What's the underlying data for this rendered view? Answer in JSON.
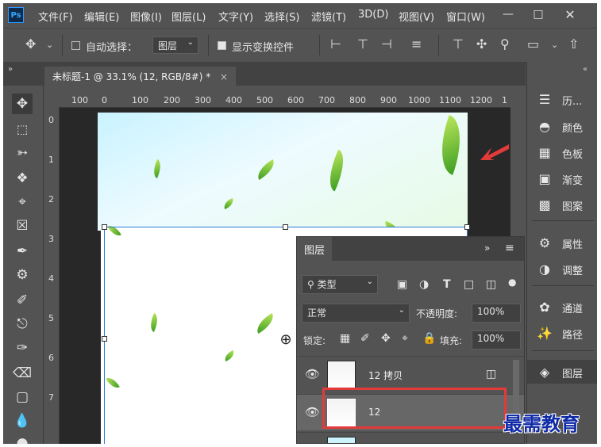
{
  "app": {
    "logo": "Ps",
    "menu": [
      "文件(F)",
      "编辑(E)",
      "图像(I)",
      "图层(L)",
      "文字(Y)",
      "选择(S)",
      "滤镜(T)",
      "3D(D)",
      "视图(V)",
      "窗口(W)"
    ],
    "window_controls": [
      "minimize-icon",
      "restore-icon",
      "close-icon"
    ]
  },
  "options_bar": {
    "auto_select_label": "自动选择：",
    "auto_select_checked": false,
    "auto_select_value": "图层",
    "show_transform_label": "显示变换控件",
    "show_transform_checked": true
  },
  "document": {
    "tab_title": "未标题-1 @ 33.1% (12, RGB/8#) *",
    "ruler_labels": [
      "100",
      "0",
      "100",
      "200",
      "300",
      "400",
      "500",
      "600",
      "700",
      "800",
      "900",
      "1000",
      "1100",
      "1200",
      "1"
    ],
    "vruler_labels": [
      "0",
      "1",
      "2",
      "3",
      "4",
      "5",
      "6",
      "7"
    ]
  },
  "right_dock": {
    "items": [
      {
        "icon": "history-icon",
        "label": "历..."
      },
      {
        "icon": "color-icon",
        "label": "颜色"
      },
      {
        "icon": "swatches-icon",
        "label": "色板"
      },
      {
        "icon": "gradient-icon",
        "label": "渐变"
      },
      {
        "icon": "pattern-icon",
        "label": "图案"
      },
      {
        "icon": "properties-icon",
        "label": "属性"
      },
      {
        "icon": "adjustments-icon",
        "label": "调整"
      },
      {
        "icon": "channels-icon",
        "label": "通道"
      },
      {
        "icon": "paths-icon",
        "label": "路径"
      },
      {
        "icon": "layers-icon",
        "label": "图层"
      }
    ]
  },
  "layers_panel": {
    "title": "图层",
    "filter_value": "类型",
    "blend_mode": "正常",
    "opacity_label": "不透明度:",
    "opacity_value": "100%",
    "lock_label": "锁定:",
    "fill_label": "填充:",
    "fill_value": "100%",
    "layers": [
      {
        "name": "12 拷贝",
        "visible": true,
        "selected": false
      },
      {
        "name": "12",
        "visible": true,
        "selected": true
      }
    ]
  },
  "watermark": "最需教育",
  "colors": {
    "annotation_red": "#e33a3a",
    "transform_blue": "#2d7bd8",
    "panel_bg": "#535353"
  }
}
